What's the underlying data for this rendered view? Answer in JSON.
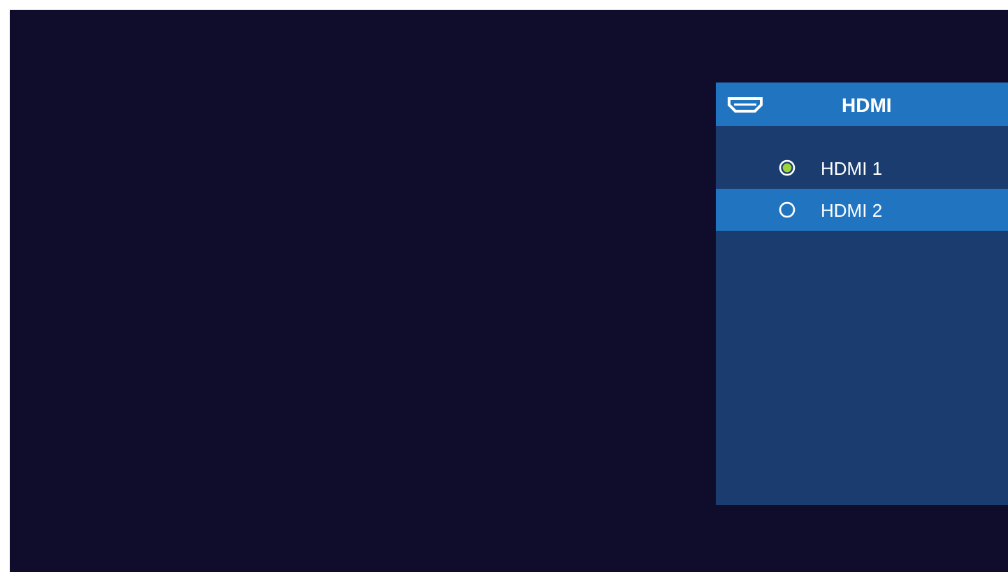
{
  "panel": {
    "title": "HDMI"
  },
  "options": [
    {
      "label": "HDMI 1",
      "selected": true,
      "focused": false
    },
    {
      "label": "HDMI 2",
      "selected": false,
      "focused": true
    }
  ]
}
